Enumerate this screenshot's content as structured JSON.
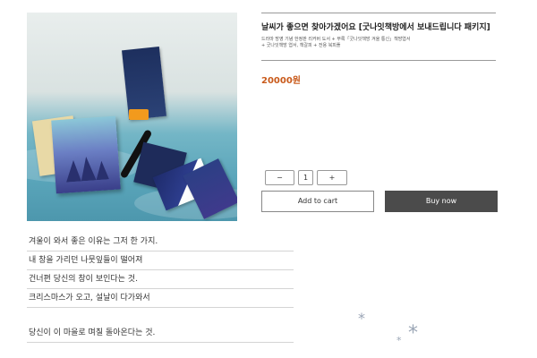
{
  "product": {
    "title": "날씨가 좋으면 찾아가겠어요 [굿나잇책방에서 보내드립니다 패키지]",
    "desc_line1": "드라마 방영 기념 한정판 리커버 도서 + 부록「굿나잇책방 겨울 통신」책방엽서",
    "desc_line2": "+ 굿나잇책방 엽서, 책갈피 + 전용 북피플",
    "price": "20000원"
  },
  "quantity": {
    "minus_label": "−",
    "value": "1",
    "plus_label": "+"
  },
  "actions": {
    "add_to_cart": "Add to cart",
    "buy_now": "Buy now"
  },
  "poem": {
    "lines": [
      "겨울이 와서 좋은 이유는 그저 한 가지.",
      "내 창을 가리던 나뭇잎들이 떨어져",
      "건너편 당신의 창이 보인다는 것.",
      "크리스마스가 오고, 설날이 다가와서",
      "",
      "당신이 이 마을로 며칠 돌아온다는 것."
    ]
  },
  "decor": {
    "snowflake": "*",
    "snow_color": "#9aa5b5",
    "price_color": "#c95b1c",
    "buy_button_color": "#4b4b4b"
  }
}
